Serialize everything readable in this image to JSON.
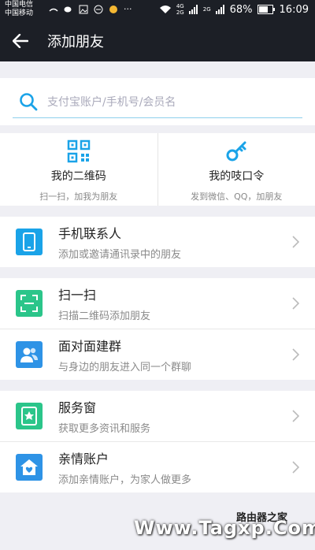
{
  "status_bar": {
    "carrier_1": "中国电信",
    "carrier_2": "中国移动",
    "network_top": "4G",
    "network_bottom": "2G",
    "network_2": "2G",
    "battery": "68%",
    "time": "16:09"
  },
  "nav": {
    "title": "添加朋友"
  },
  "search": {
    "placeholder": "支付宝账户/手机号/会员名"
  },
  "quick_actions": [
    {
      "title": "我的二维码",
      "subtitle": "扫一扫，加我为朋友",
      "icon": "qr-code-icon"
    },
    {
      "title": "我的吱口令",
      "subtitle": "发到微信、QQ，加朋友",
      "icon": "key-icon"
    }
  ],
  "groups": [
    [
      {
        "title": "手机联系人",
        "subtitle": "添加或邀请通讯录中的朋友",
        "icon": "phone-icon",
        "color": "#1aa3e8"
      }
    ],
    [
      {
        "title": "扫一扫",
        "subtitle": "扫描二维码添加朋友",
        "icon": "scan-icon",
        "color": "#2bc58a"
      },
      {
        "title": "面对面建群",
        "subtitle": "与身边的朋友进入同一个群聊",
        "icon": "group-users-icon",
        "color": "#2e93e6"
      }
    ],
    [
      {
        "title": "服务窗",
        "subtitle": "获取更多资讯和服务",
        "icon": "service-window-icon",
        "color": "#2bc58a"
      },
      {
        "title": "亲情账户",
        "subtitle": "添加亲情账户，为家人做更多",
        "icon": "family-home-icon",
        "color": "#2e93e6"
      }
    ]
  ],
  "watermark": {
    "text": "Www.Tagxp.Com",
    "sub": "路由器之家"
  },
  "colors": {
    "header_bg": "#1c1f26",
    "accent_blue": "#1aa3e8",
    "accent_green": "#2bc58a"
  }
}
